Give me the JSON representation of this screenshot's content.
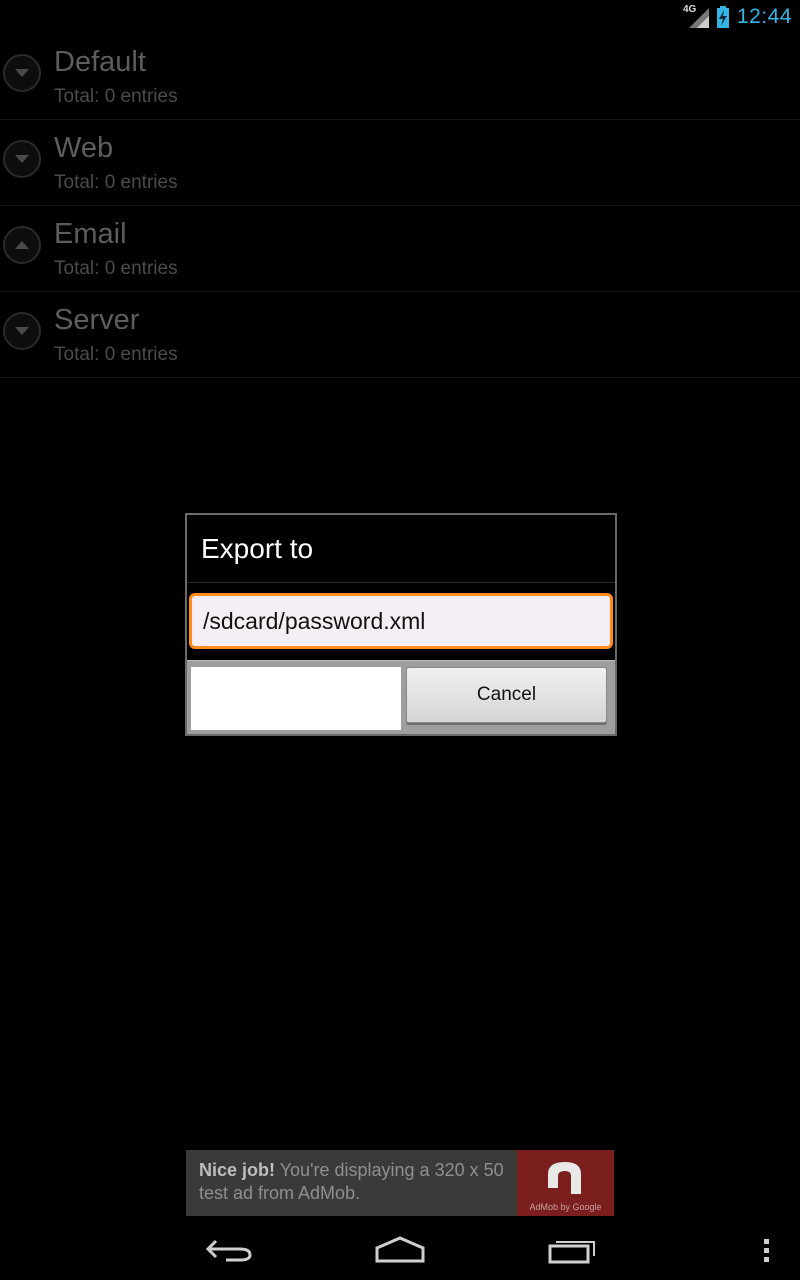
{
  "status_bar": {
    "network": "4G",
    "time": "12:44",
    "icons": [
      "signal-icon",
      "battery-charging-icon"
    ]
  },
  "groups": [
    {
      "title": "Default",
      "subtitle": "Total: 0 entries",
      "icon": "collapse-down-icon"
    },
    {
      "title": "Web",
      "subtitle": "Total: 0 entries",
      "icon": "collapse-down-icon"
    },
    {
      "title": "Email",
      "subtitle": "Total: 0 entries",
      "icon": "expand-up-icon"
    },
    {
      "title": "Server",
      "subtitle": "Total: 0 entries",
      "icon": "collapse-down-icon"
    }
  ],
  "dialog": {
    "title": "Export to",
    "input_value": "/sdcard/password.xml",
    "positive_label": "",
    "cancel_label": "Cancel"
  },
  "ad": {
    "headline": "Nice job!",
    "body": " You're displaying a 320 x 50 test ad from AdMob.",
    "brand": "AdMob by Google"
  },
  "navbar": {
    "icons": [
      "back-icon",
      "home-icon",
      "recent-apps-icon",
      "overflow-menu-icon"
    ]
  },
  "colors": {
    "accent": "#33b5e5",
    "focus": "#ff8a1d"
  }
}
